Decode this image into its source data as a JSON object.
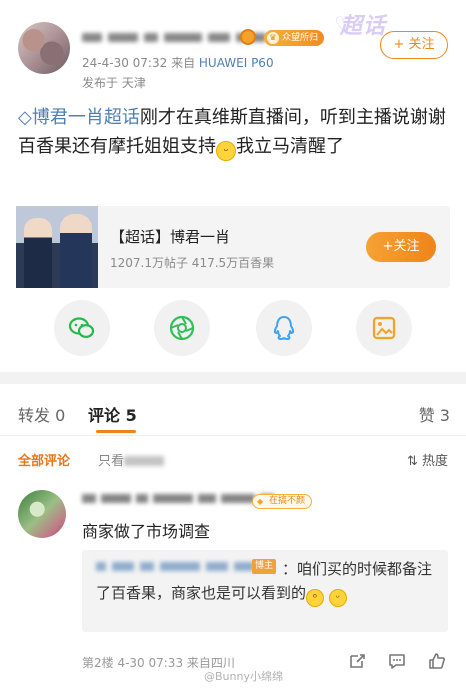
{
  "post": {
    "meta_time": "24-4-30 07:32",
    "meta_from": "来自",
    "meta_device": "HUAWEI P60",
    "location": "发布于 天津",
    "crowd_badge": "众望所归",
    "super_label": "超话",
    "follow_label": "+ 关注",
    "topic_link": "博君一肖超话",
    "text_main": "刚才在真维斯直播间，听到主播说谢谢百香果还有摩托姐姐支持",
    "text_tail": "我立马清醒了"
  },
  "topic_card": {
    "title": "【超话】博君一肖",
    "stats": "1207.1万帖子 417.5万百香果",
    "follow_label": "+关注"
  },
  "share": {
    "icons": [
      "wechat-icon",
      "moments-icon",
      "qq-icon",
      "image-save-icon"
    ],
    "colors": {
      "wechat": "#25b94a",
      "moments": "#2fbf55",
      "qq": "#3ba3f0",
      "save": "#f4a224"
    }
  },
  "tabs": {
    "repost": "转发 0",
    "comment": "评论 5",
    "like": "赞 3"
  },
  "filter": {
    "all": "全部评论",
    "only": "只看",
    "hot": "热度"
  },
  "comment": {
    "badge": "在搞不颜",
    "text": "商家做了市场调查",
    "reply_tag": "博主",
    "reply_text": "：咱们买的时候都备注了百香果，商家也是可以看到的",
    "meta": "第2楼 4-30 07:33 来自四川"
  },
  "watermark": "@Bunny小绵绵",
  "accent": "#f08419",
  "link_color": "#4f7fb4"
}
